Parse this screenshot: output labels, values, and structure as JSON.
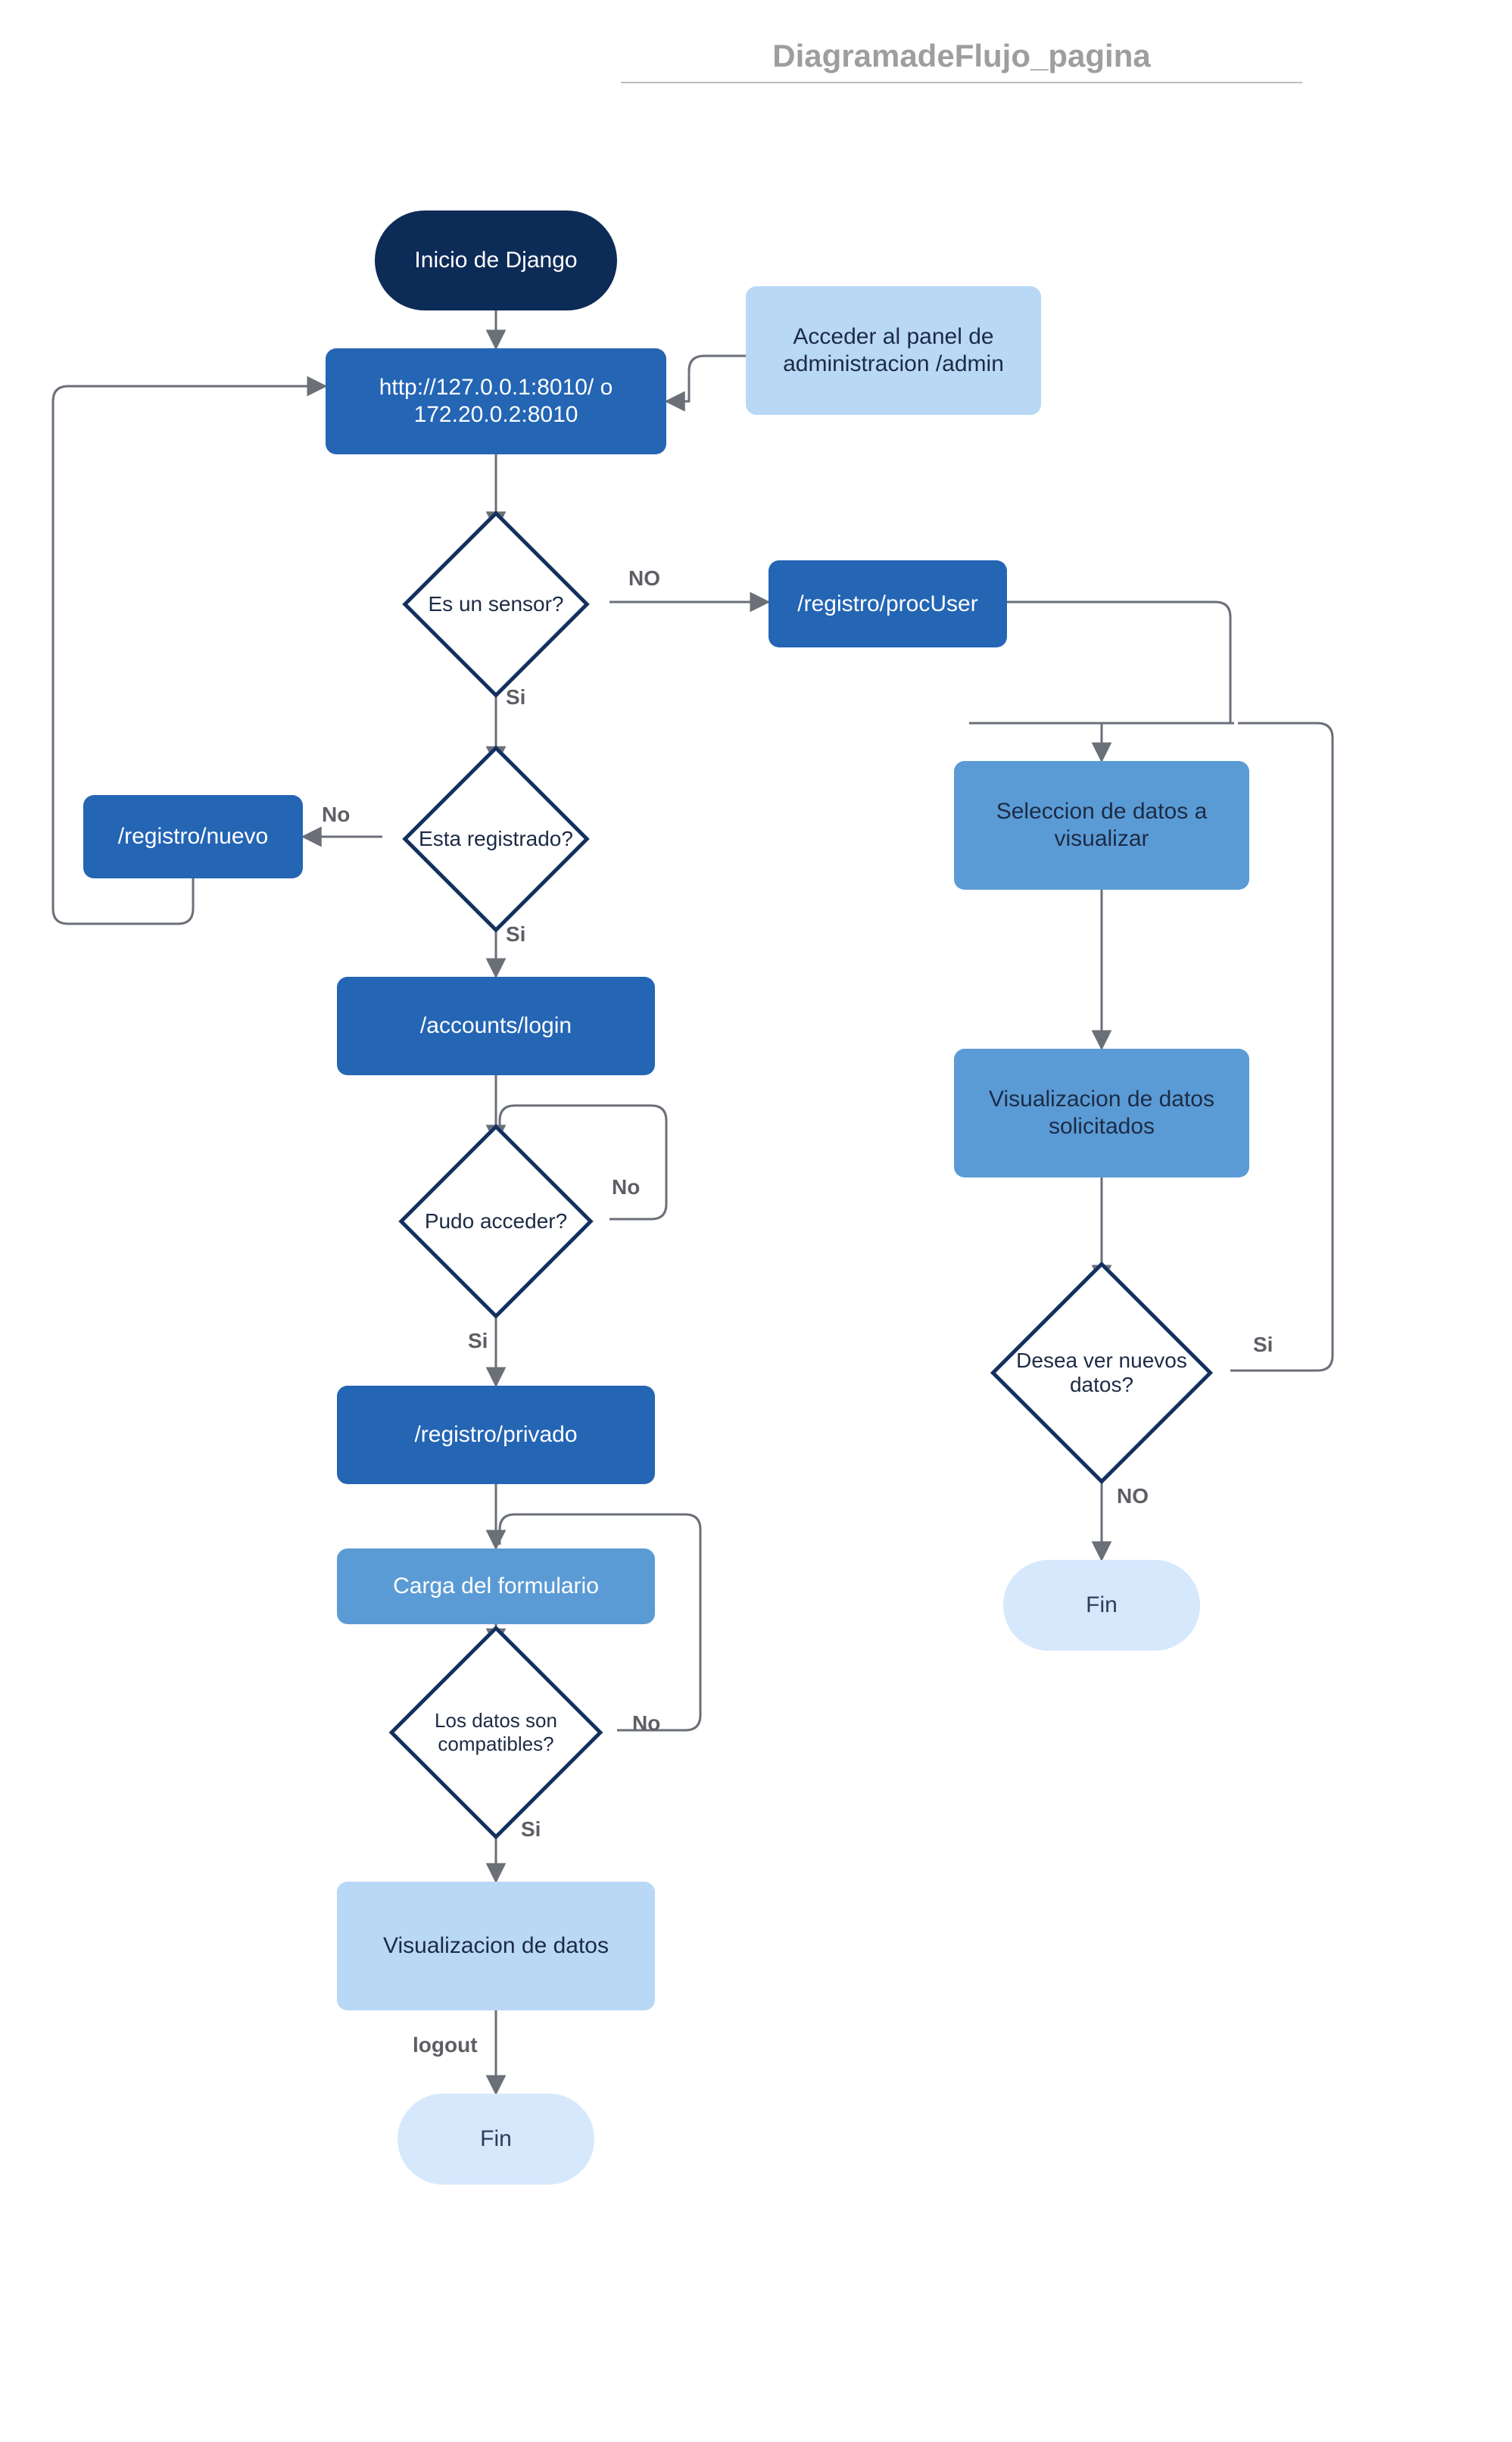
{
  "title": "DiagramadeFlujo_pagina",
  "nodes": {
    "start": {
      "label": "Inicio de Django"
    },
    "url": {
      "label": "http://127.0.0.1:8010/ o 172.20.0.2:8010"
    },
    "admin": {
      "label": "Acceder al panel de administracion /admin"
    },
    "d_sensor": {
      "label": "Es un sensor?"
    },
    "procuser": {
      "label": "/registro/procUser"
    },
    "d_reg": {
      "label": "Esta registrado?"
    },
    "nuevo": {
      "label": "/registro/nuevo"
    },
    "login": {
      "label": "/accounts/login"
    },
    "d_access": {
      "label": "Pudo acceder?"
    },
    "privado": {
      "label": "/registro/privado"
    },
    "form": {
      "label": "Carga del formulario"
    },
    "d_compat": {
      "label": "Los datos son compatibles?"
    },
    "vizdatos": {
      "label": "Visualizacion de datos"
    },
    "fin_left": {
      "label": "Fin"
    },
    "select": {
      "label": "Seleccion de datos a visualizar"
    },
    "vizsol": {
      "label": "Visualizacion de datos solicitados"
    },
    "d_more": {
      "label": "Desea ver nuevos datos?"
    },
    "fin_right": {
      "label": "Fin"
    }
  },
  "edges": {
    "no_upper": "NO",
    "si_lower": "Si",
    "no_lower": "No",
    "si_cap": "Si",
    "logout": "logout",
    "no_right": "NO",
    "si_right": "Si"
  },
  "colors": {
    "dark_navy": "#0d2b57",
    "blue": "#2465b4",
    "mid_blue": "#5b9bd5",
    "light_blue": "#b9d8f6",
    "end_blue": "#d6e8fc",
    "border": "#13305f",
    "edge": "#6b6f78",
    "title": "#9e9e9e"
  }
}
